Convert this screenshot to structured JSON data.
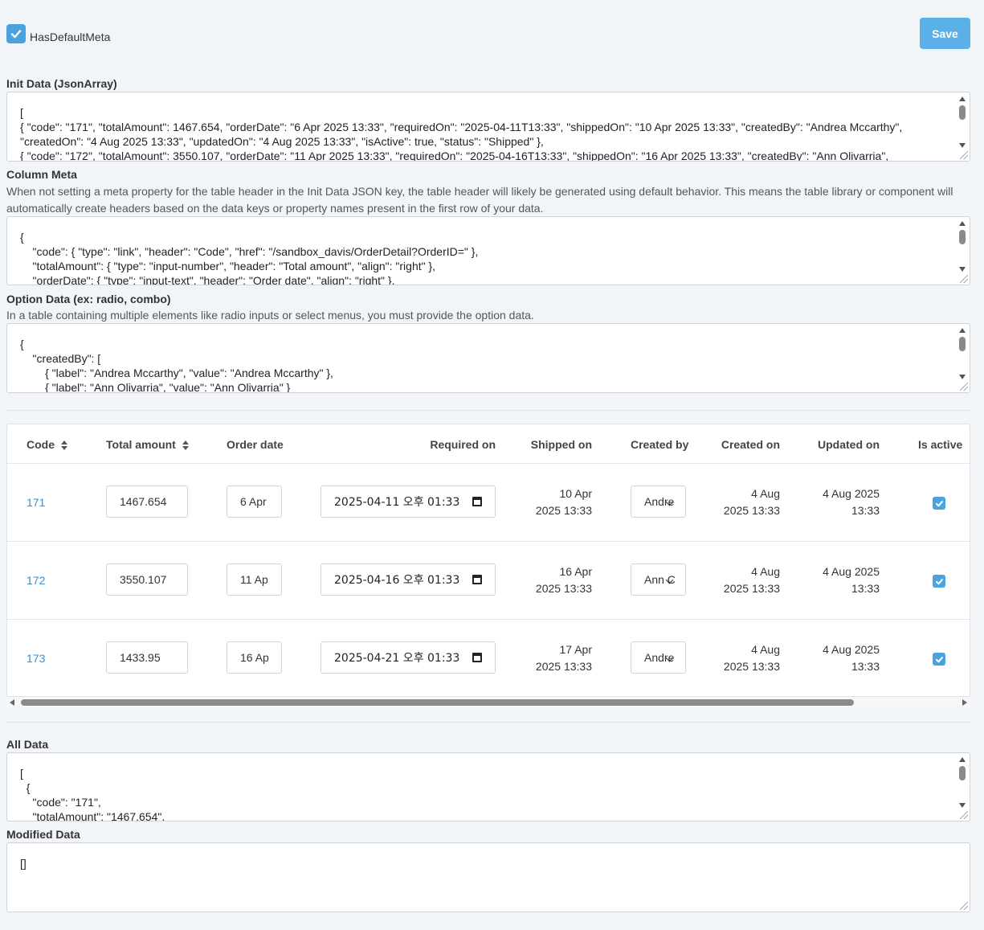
{
  "header": {
    "has_default_meta_label": "HasDefaultMeta",
    "has_default_meta_checked": true,
    "save_label": "Save"
  },
  "init_data": {
    "title": "Init Data (JsonArray)",
    "text": "[\n{ \"code\": \"171\", \"totalAmount\": 1467.654, \"orderDate\": \"6 Apr 2025 13:33\", \"requiredOn\": \"2025-04-11T13:33\", \"shippedOn\": \"10 Apr 2025 13:33\", \"createdBy\": \"Andrea Mccarthy\",\n\"createdOn\": \"4 Aug 2025 13:33\", \"updatedOn\": \"4 Aug 2025 13:33\", \"isActive\": true, \"status\": \"Shipped\" },\n{ \"code\": \"172\", \"totalAmount\": 3550.107, \"orderDate\": \"11 Apr 2025 13:33\", \"requiredOn\": \"2025-04-16T13:33\", \"shippedOn\": \"16 Apr 2025 13:33\", \"createdBy\": \"Ann Olivarria\","
  },
  "column_meta": {
    "title": "Column Meta",
    "description": "When not setting a meta property for the table header in the Init Data JSON key, the table header will likely be generated using default behavior. This means the table library or component will automatically create headers based on the data keys or property names present in the first row of your data.",
    "text": "{\n    \"code\": { \"type\": \"link\", \"header\": \"Code\", \"href\": \"/sandbox_davis/OrderDetail?OrderID=\" },\n    \"totalAmount\": { \"type\": \"input-number\", \"header\": \"Total amount\", \"align\": \"right\" },\n    \"orderDate\": { \"type\": \"input-text\", \"header\": \"Order date\", \"align\": \"right\" },"
  },
  "option_data": {
    "title": "Option Data (ex: radio, combo)",
    "description": "In a table containing multiple elements like radio inputs or select menus, you must provide the option data.",
    "text": "{\n    \"createdBy\": [\n        { \"label\": \"Andrea Mccarthy\", \"value\": \"Andrea Mccarthy\" },\n        { \"label\": \"Ann Olivarria\", \"value\": \"Ann Olivarria\" }"
  },
  "table": {
    "columns": [
      "Code",
      "Total amount",
      "Order date",
      "Required on",
      "Shipped on",
      "Created by",
      "Created on",
      "Updated on",
      "Is active"
    ],
    "rows": [
      {
        "code": "171",
        "total_amount": "1467.654",
        "order_date": "6 Apr",
        "required_on": "2025-04-11 오후 01:33",
        "shipped_on_1": "10 Apr",
        "shipped_on_2": "2025 13:33",
        "created_by": "Andre",
        "created_on_1": "4 Aug",
        "created_on_2": "2025 13:33",
        "updated_on_1": "4 Aug 2025",
        "updated_on_2": "13:33",
        "is_active": true
      },
      {
        "code": "172",
        "total_amount": "3550.107",
        "order_date": "11 Ap",
        "required_on": "2025-04-16 오후 01:33",
        "shipped_on_1": "16 Apr",
        "shipped_on_2": "2025 13:33",
        "created_by": "Ann C",
        "created_on_1": "4 Aug",
        "created_on_2": "2025 13:33",
        "updated_on_1": "4 Aug 2025",
        "updated_on_2": "13:33",
        "is_active": true
      },
      {
        "code": "173",
        "total_amount": "1433.95",
        "order_date": "16 Ap",
        "required_on": "2025-04-21 오후 01:33",
        "shipped_on_1": "17 Apr",
        "shipped_on_2": "2025 13:33",
        "created_by": "Andre",
        "created_on_1": "4 Aug",
        "created_on_2": "2025 13:33",
        "updated_on_1": "4 Aug 2025",
        "updated_on_2": "13:33",
        "is_active": true
      }
    ]
  },
  "all_data": {
    "title": "All Data",
    "text": "[\n  {\n    \"code\": \"171\",\n    \"totalAmount\": \"1467.654\","
  },
  "modified_data": {
    "title": "Modified Data",
    "text": "[]"
  },
  "colors": {
    "accent": "#4aa3df",
    "link": "#3a8fd0",
    "save_button": "#5bb0e8",
    "background": "#f2f5f8"
  }
}
